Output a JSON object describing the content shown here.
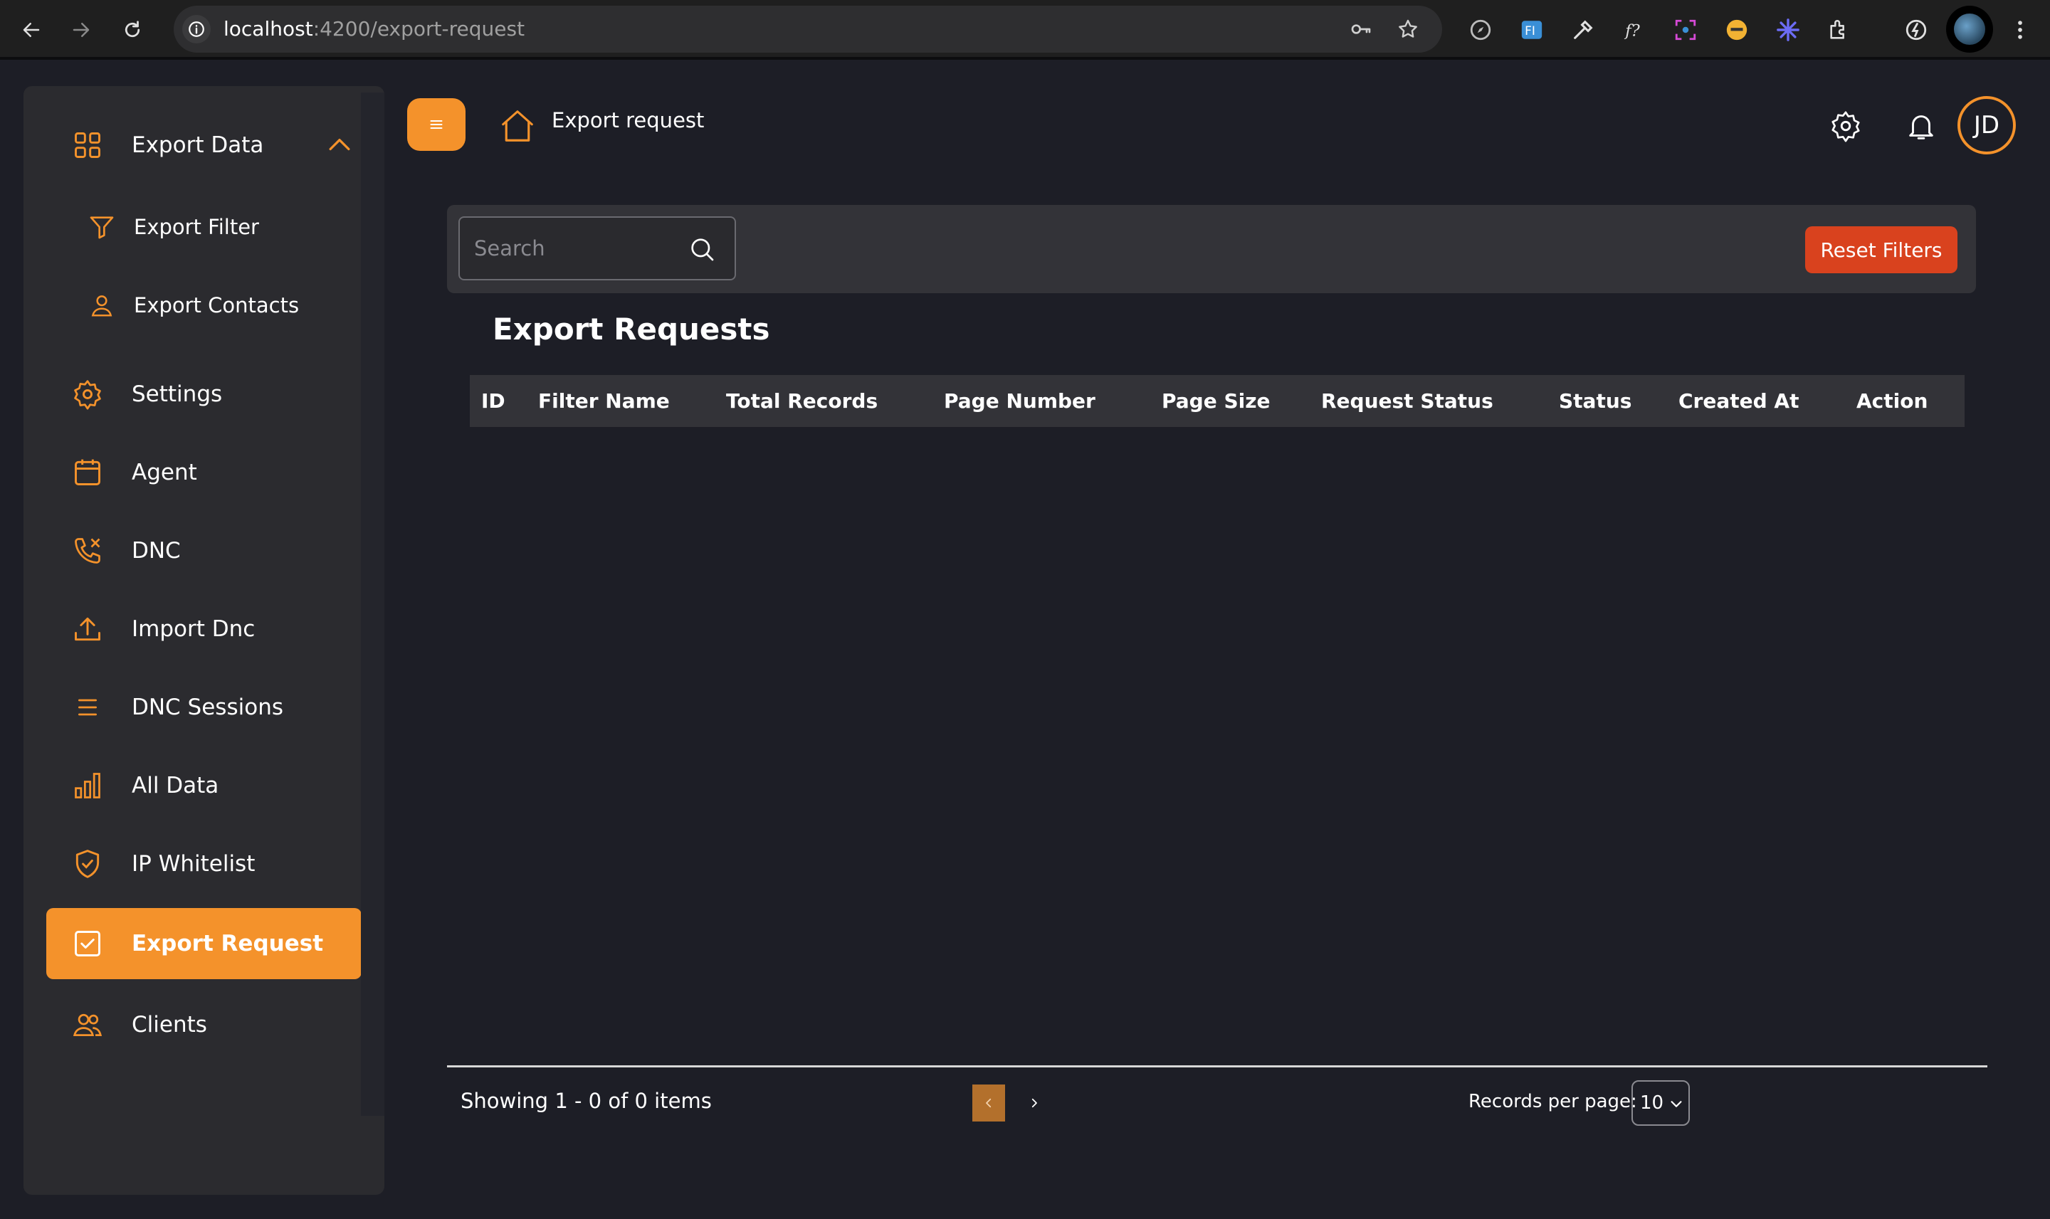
{
  "browser": {
    "url_host": "localhost",
    "url_path": ":4200/export-request"
  },
  "sidebar": {
    "items": [
      {
        "label": "Export Data",
        "icon": "grid-icon"
      },
      {
        "label": "Export Filter",
        "icon": "filter-icon"
      },
      {
        "label": "Export Contacts",
        "icon": "user-icon"
      },
      {
        "label": "Settings",
        "icon": "gear-icon"
      },
      {
        "label": "Agent",
        "icon": "calendar-icon"
      },
      {
        "label": "DNC",
        "icon": "phone-off-icon"
      },
      {
        "label": "Import Dnc",
        "icon": "upload-icon"
      },
      {
        "label": "DNC Sessions",
        "icon": "list-icon"
      },
      {
        "label": "All Data",
        "icon": "bar-chart-icon"
      },
      {
        "label": "IP Whitelist",
        "icon": "shield-icon"
      },
      {
        "label": "Export Request",
        "icon": "checkbox-icon",
        "active": true
      },
      {
        "label": "Clients",
        "icon": "users-icon"
      }
    ]
  },
  "header": {
    "breadcrumb": "Export request",
    "avatar_initials": "JD"
  },
  "filters": {
    "search_placeholder": "Search",
    "reset_label": "Reset Filters"
  },
  "main": {
    "title": "Export Requests",
    "columns": [
      "ID",
      "Filter Name",
      "Total Records",
      "Page Number",
      "Page Size",
      "Request Status",
      "Status",
      "Created At",
      "Action"
    ],
    "rows": []
  },
  "pagination": {
    "showing": "Showing 1 - 0 of 0 items",
    "records_per_page_label": "Records per page:",
    "records_per_page_value": "10"
  },
  "colors": {
    "accent": "#f4922b",
    "danger": "#d9421e",
    "background": "#1d1e26",
    "panel": "#2b2b2f"
  }
}
